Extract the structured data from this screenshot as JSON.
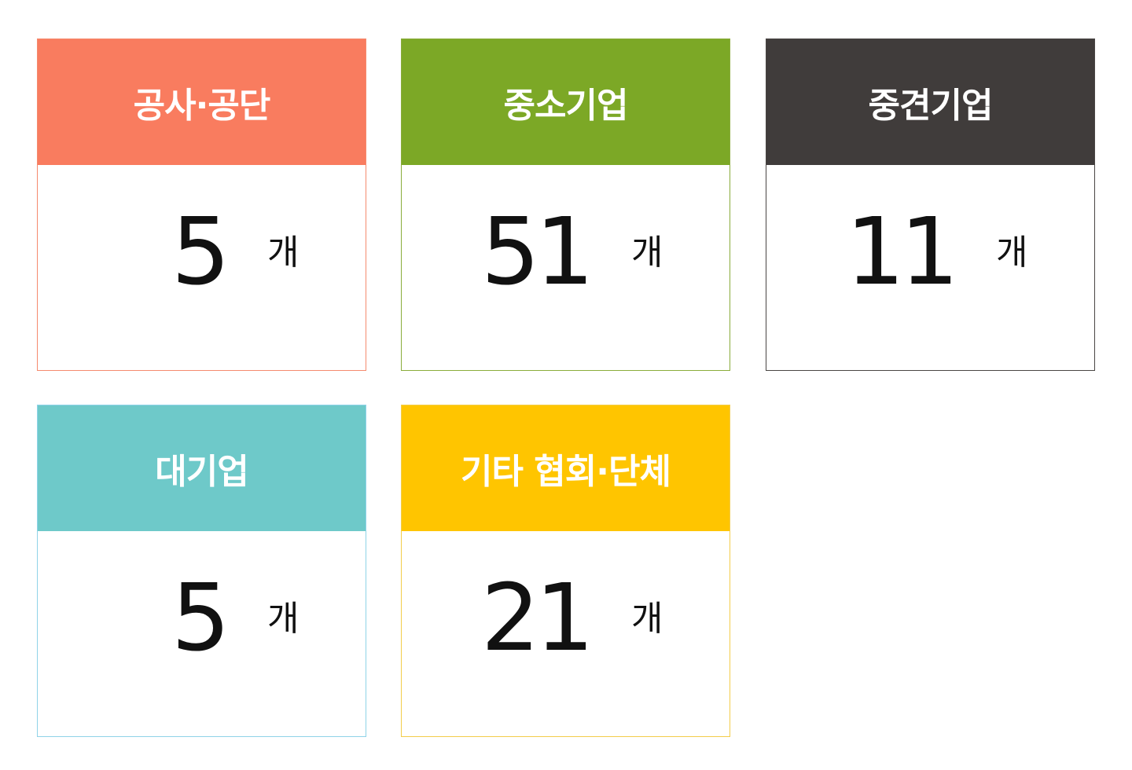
{
  "cards": [
    {
      "category": "공사·공단",
      "count": "5",
      "unit": "개",
      "header_color": "#f97c5f",
      "border_color": "#f58a6e"
    },
    {
      "category": "중소기업",
      "count": "51",
      "unit": "개",
      "header_color": "#7ca826",
      "border_color": "#8aac3b"
    },
    {
      "category": "중견기업",
      "count": "11",
      "unit": "개",
      "header_color": "#403c3b",
      "border_color": "#4a4644"
    },
    {
      "category": "대기업",
      "count": "5",
      "unit": "개",
      "header_color": "#6ec9c9",
      "border_color": "#8fd3e8"
    },
    {
      "category": "기타 협회·단체",
      "count": "21",
      "unit": "개",
      "header_color": "#ffc500",
      "border_color": "#f3cd4a"
    }
  ]
}
